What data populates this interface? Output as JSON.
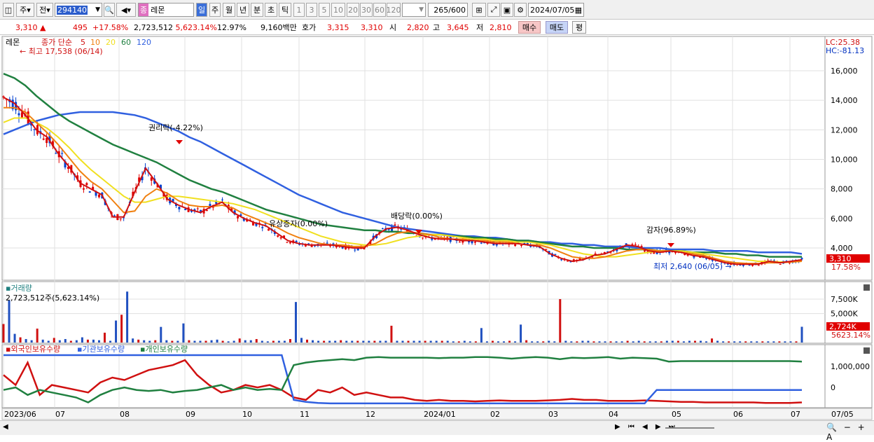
{
  "toolbar": {
    "code": "294140",
    "name": "레몬",
    "market_tag": "종",
    "menu_stock": "주",
    "menu_all": "전",
    "periods": [
      "일",
      "주",
      "월",
      "년",
      "분",
      "초",
      "틱"
    ],
    "intervals": [
      "1",
      "3",
      "5",
      "10",
      "20",
      "30",
      "60",
      "120"
    ],
    "count": "265",
    "count_total": "/600",
    "date": "2024/07/05"
  },
  "quote": {
    "price": "3,310",
    "change": "495",
    "change_pct": "+17.58%",
    "volume": "2,723,512",
    "volume_pct": "5,623.14%",
    "turnover": "12.97%",
    "amount": "9,160백만",
    "ask_label": "호가",
    "ask": "3,315",
    "bid": "3,310",
    "open_label": "시",
    "open": "2,820",
    "high_label": "고",
    "high": "3,645",
    "low_label": "저",
    "low": "2,810",
    "buy": "매수",
    "sell": "매도",
    "avg": "평"
  },
  "price_panel": {
    "title": "레몬",
    "legend_label": "종가 단순",
    "ma_periods": [
      "5",
      "10",
      "20",
      "60",
      "120"
    ],
    "ma_colors": [
      "#d01010",
      "#f08010",
      "#f0e020",
      "#208040",
      "#3060e0"
    ],
    "high_note": "최고 17,538 (06/14)",
    "low_note": "최저 2,640 (06/05)",
    "events": [
      "권리락(-4.22%)",
      "유상증자(0.00%)",
      "배당락(0.00%)",
      "감자(96.89%)"
    ],
    "lc": "LC:25.38",
    "hc": "HC:-81.13",
    "last_price": "3,310",
    "last_pct": "17.58%"
  },
  "volume_panel": {
    "title": "거래량",
    "info": "2,723,512주(5,623.14%)",
    "last": "2,724K",
    "last_pct": "5623.14%"
  },
  "holdings_panel": {
    "legend": [
      "외국인보유수량",
      "기관보유수량",
      "개인보유수량"
    ],
    "legend_colors": [
      "#d01010",
      "#3060e0",
      "#208040"
    ]
  },
  "chart_data": [
    {
      "type": "line",
      "title": "레몬",
      "y_ticks": [
        "16,000",
        "14,000",
        "12,000",
        "10,000",
        "8,000",
        "6,000",
        "4,000"
      ],
      "x_ticks": [
        "2023/06",
        "07",
        "08",
        "09",
        "10",
        "11",
        "12",
        "2024/01",
        "02",
        "03",
        "04",
        "05",
        "06",
        "07",
        "07/05"
      ],
      "series": [
        {
          "name": "5",
          "values": [
            14200,
            13800,
            13000,
            12000,
            11500,
            10400,
            9500,
            8400,
            8000,
            7600,
            6100,
            6100,
            7800,
            9400,
            8400,
            7300,
            6900,
            6600,
            6400,
            6800,
            7100,
            6400,
            6000,
            5700,
            5500,
            5000,
            4500,
            4300,
            4200,
            4200,
            4200,
            4100,
            4000,
            4000,
            4800,
            5300,
            5400,
            5200,
            4900,
            4700,
            4600,
            4600,
            4500,
            4500,
            4400,
            4300,
            4300,
            4300,
            4200,
            4100,
            3600,
            3300,
            3100,
            3200,
            3500,
            3600,
            3900,
            4200,
            4100,
            3800,
            3700,
            3800,
            3700,
            3500,
            3400,
            3200,
            3000,
            2900,
            2900,
            2900,
            3100,
            3000,
            3100,
            3200
          ],
          "ma": "5"
        },
        {
          "name": "10",
          "values": [
            13500,
            13500,
            13200,
            12500,
            11800,
            11000,
            10100,
            9200,
            8500,
            8000,
            7200,
            6400,
            6500,
            7500,
            8000,
            7700,
            7200,
            6900,
            6800,
            6800,
            6900,
            6700,
            6300,
            6000,
            5700,
            5400,
            5000,
            4700,
            4500,
            4300,
            4200,
            4200,
            4100,
            4100,
            4300,
            4700,
            5000,
            5100,
            5000,
            4900,
            4700,
            4600,
            4600,
            4500,
            4500,
            4400,
            4400,
            4300,
            4200,
            4200,
            4000,
            3700,
            3400,
            3300,
            3300,
            3400,
            3600,
            3800,
            3900,
            3900,
            3800,
            3800,
            3700,
            3600,
            3500,
            3300,
            3100,
            3000,
            2950,
            2950,
            3000,
            3000,
            3050,
            3100
          ],
          "ma": "10"
        },
        {
          "name": "20",
          "values": [
            12500,
            12800,
            12800,
            12500,
            12100,
            11500,
            10800,
            10000,
            9300,
            8700,
            8100,
            7500,
            7100,
            7100,
            7300,
            7500,
            7500,
            7400,
            7300,
            7200,
            7100,
            7000,
            6800,
            6600,
            6300,
            6000,
            5700,
            5400,
            5100,
            4800,
            4600,
            4400,
            4300,
            4200,
            4200,
            4300,
            4500,
            4700,
            4800,
            4900,
            4900,
            4800,
            4700,
            4600,
            4600,
            4500,
            4500,
            4400,
            4400,
            4300,
            4200,
            4000,
            3800,
            3600,
            3500,
            3400,
            3400,
            3500,
            3600,
            3700,
            3800,
            3800,
            3800,
            3700,
            3600,
            3500,
            3400,
            3300,
            3200,
            3100,
            3100,
            3050,
            3050,
            3100
          ],
          "ma": "20"
        },
        {
          "name": "60",
          "values": [
            15800,
            15500,
            15000,
            14300,
            13700,
            13100,
            12600,
            12200,
            11800,
            11400,
            11000,
            10700,
            10400,
            10100,
            9800,
            9400,
            9000,
            8600,
            8300,
            8000,
            7800,
            7500,
            7200,
            6900,
            6600,
            6400,
            6200,
            6000,
            5800,
            5600,
            5500,
            5400,
            5300,
            5200,
            5200,
            5100,
            5100,
            5000,
            5000,
            4900,
            4900,
            4800,
            4800,
            4700,
            4700,
            4600,
            4600,
            4500,
            4500,
            4400,
            4300,
            4200,
            4100,
            4100,
            4000,
            4000,
            4000,
            3900,
            3900,
            3900,
            3800,
            3800,
            3800,
            3700,
            3700,
            3700,
            3600,
            3600,
            3500,
            3500,
            3400,
            3400,
            3400,
            3400
          ],
          "ma": "60"
        },
        {
          "name": "120",
          "values": [
            11700,
            12000,
            12300,
            12600,
            12800,
            13000,
            13100,
            13200,
            13200,
            13200,
            13200,
            13100,
            13000,
            12800,
            12500,
            12200,
            11900,
            11500,
            11200,
            10800,
            10400,
            10000,
            9600,
            9200,
            8800,
            8400,
            8000,
            7600,
            7300,
            7000,
            6700,
            6400,
            6200,
            6000,
            5800,
            5600,
            5400,
            5300,
            5200,
            5100,
            5000,
            4900,
            4800,
            4800,
            4700,
            4700,
            4600,
            4500,
            4500,
            4400,
            4400,
            4300,
            4300,
            4200,
            4200,
            4100,
            4100,
            4100,
            4000,
            4000,
            4000,
            3900,
            3900,
            3900,
            3900,
            3800,
            3800,
            3800,
            3800,
            3700,
            3700,
            3700,
            3700,
            3600
          ],
          "ma": "120"
        }
      ]
    },
    {
      "type": "bar",
      "title": "거래량",
      "y_ticks": [
        "7,500K",
        "5,000K"
      ],
      "series": [
        {
          "name": "거래량",
          "values": [
            3200,
            7300,
            1500,
            900,
            600,
            400,
            2400,
            500,
            300,
            800,
            400,
            600,
            300,
            400,
            900,
            500,
            500,
            400,
            1700,
            300,
            3800,
            4800,
            8800,
            700,
            500,
            400,
            300,
            400,
            2700,
            400,
            300,
            300,
            3300,
            400,
            300,
            300,
            300,
            400,
            500,
            300,
            200,
            300,
            700,
            400,
            400,
            600,
            300,
            200,
            300,
            300,
            300,
            600,
            7000,
            800,
            500,
            400,
            300,
            300,
            300,
            300,
            400,
            300,
            300,
            300,
            300,
            300,
            300,
            300,
            300,
            2900,
            300,
            300,
            300,
            300,
            300,
            300,
            300,
            300,
            300,
            300,
            200,
            200,
            300,
            200,
            200,
            2500,
            200,
            300,
            200,
            200,
            300,
            200,
            3100,
            400,
            200,
            200,
            200,
            300,
            200,
            7500,
            300,
            200,
            200,
            300,
            300,
            200,
            200,
            200,
            200,
            200,
            200,
            300,
            200,
            300,
            200,
            200,
            200,
            200,
            300,
            300,
            300,
            200,
            300,
            300,
            300,
            200,
            700,
            300,
            200,
            200,
            200,
            200,
            200,
            200,
            200,
            200,
            200,
            200,
            200,
            200,
            200,
            200,
            2724
          ]
        }
      ]
    },
    {
      "type": "line",
      "title": "보유수량",
      "y_ticks": [
        "1,000,000",
        "0"
      ],
      "series": [
        {
          "name": "외국인보유수량",
          "values": [
            60,
            40,
            85,
            20,
            40,
            35,
            30,
            25,
            45,
            55,
            50,
            60,
            70,
            75,
            80,
            90,
            60,
            40,
            25,
            30,
            40,
            35,
            40,
            30,
            15,
            10,
            30,
            25,
            35,
            20,
            25,
            20,
            15,
            15,
            10,
            8,
            10,
            8,
            8,
            7,
            8,
            9,
            8,
            8,
            8,
            9,
            10,
            12,
            10,
            10,
            8,
            8,
            8,
            9,
            8,
            7,
            6,
            6,
            5,
            5,
            5,
            5,
            5,
            4,
            4,
            4,
            5
          ],
          "color": "#d01010"
        },
        {
          "name": "기관보유수량",
          "values": [
            100,
            100,
            100,
            100,
            100,
            100,
            100,
            100,
            100,
            100,
            100,
            100,
            100,
            100,
            100,
            100,
            100,
            100,
            100,
            100,
            100,
            100,
            100,
            100,
            10,
            6,
            4,
            3,
            3,
            3,
            3,
            3,
            3,
            3,
            3,
            3,
            3,
            3,
            3,
            3,
            3,
            3,
            3,
            3,
            3,
            3,
            3,
            3,
            3,
            3,
            3,
            3,
            3,
            3,
            30,
            30,
            30,
            30,
            30,
            30,
            30,
            30,
            30,
            30,
            30,
            30,
            30
          ],
          "color": "#3060e0"
        },
        {
          "name": "개인보유수량",
          "values": [
            30,
            35,
            20,
            30,
            25,
            20,
            15,
            5,
            20,
            30,
            35,
            30,
            28,
            30,
            25,
            28,
            30,
            35,
            40,
            30,
            35,
            30,
            32,
            30,
            80,
            85,
            88,
            90,
            92,
            90,
            95,
            96,
            95,
            95,
            95,
            95,
            94,
            95,
            95,
            96,
            96,
            95,
            93,
            95,
            96,
            95,
            92,
            95,
            94,
            95,
            96,
            93,
            95,
            94,
            93,
            87,
            88,
            88,
            88,
            88,
            88,
            88,
            88,
            88,
            88,
            88,
            87
          ],
          "color": "#208040"
        }
      ]
    }
  ]
}
